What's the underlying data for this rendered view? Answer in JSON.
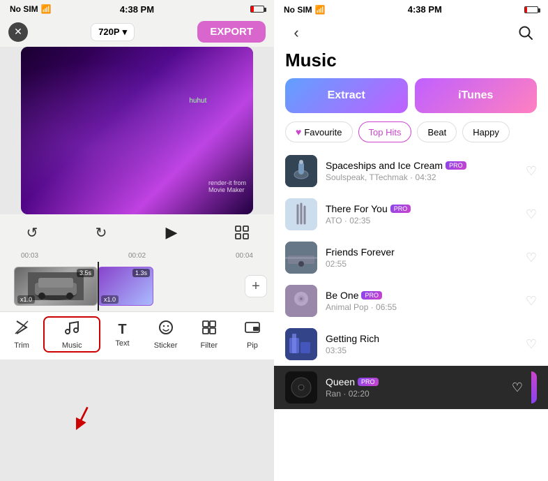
{
  "left": {
    "status": {
      "no_sim": "No SIM",
      "wifi": "WiFi",
      "time": "4:38 PM"
    },
    "close_label": "✕",
    "resolution": "720P",
    "resolution_arrow": "▾",
    "export_label": "EXPORT",
    "controls": {
      "undo": "↺",
      "redo": "↻",
      "play": "▶",
      "fullscreen": "⛶"
    },
    "timeline_marks": [
      "00:03",
      "00:02",
      "00:04"
    ],
    "clips": [
      {
        "duration": "3.5s",
        "speed": "x1.0"
      },
      {
        "duration": "1.3s",
        "speed": "x1.0"
      }
    ],
    "toolbar_items": [
      {
        "id": "trim",
        "icon": "✂",
        "label": "Trim"
      },
      {
        "id": "music",
        "icon": "♫",
        "label": "Music"
      },
      {
        "id": "text",
        "icon": "T",
        "label": "Text"
      },
      {
        "id": "sticker",
        "icon": "☺",
        "label": "Sticker"
      },
      {
        "id": "filter",
        "icon": "⊞",
        "label": "Filter"
      },
      {
        "id": "pip",
        "icon": "◫",
        "label": "Pip"
      }
    ]
  },
  "right": {
    "status": {
      "no_sim": "No SIM",
      "wifi": "WiFi",
      "time": "4:38 PM"
    },
    "back_icon": "‹",
    "search_icon": "⌕",
    "title": "Music",
    "source_tabs": [
      {
        "id": "extract",
        "label": "Extract"
      },
      {
        "id": "itunes",
        "label": "iTunes"
      }
    ],
    "category_tabs": [
      {
        "id": "favourite",
        "label": "Favourite",
        "icon": "♥",
        "active": false
      },
      {
        "id": "top_hits",
        "label": "Top Hits",
        "active": true
      },
      {
        "id": "beat",
        "label": "Beat",
        "active": false
      },
      {
        "id": "happy",
        "label": "Happy",
        "active": false
      }
    ],
    "songs": [
      {
        "id": "spaceships",
        "name": "Spaceships and Ice Cream",
        "artist": "Soulspeak, TTechmak",
        "duration": "04:32",
        "pro": true,
        "active": false
      },
      {
        "id": "there_for_you",
        "name": "There For You",
        "artist": "ATO",
        "duration": "02:35",
        "pro": true,
        "active": false
      },
      {
        "id": "friends_forever",
        "name": "Friends Forever",
        "artist": "",
        "duration": "02:55",
        "pro": false,
        "active": false
      },
      {
        "id": "be_one",
        "name": "Be One",
        "artist": "Animal Pop",
        "duration": "06:55",
        "pro": true,
        "active": false
      },
      {
        "id": "getting_rich",
        "name": "Getting Rich",
        "artist": "",
        "duration": "03:35",
        "pro": false,
        "active": false
      },
      {
        "id": "queen",
        "name": "Queen",
        "artist": "Ran",
        "duration": "02:20",
        "pro": true,
        "active": true
      }
    ]
  }
}
